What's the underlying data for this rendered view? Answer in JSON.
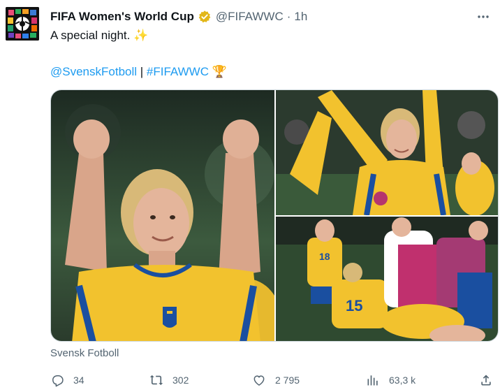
{
  "author": {
    "display_name": "FIFA Women's World Cup",
    "handle": "@FIFAWWC",
    "separator": "·",
    "timestamp": "1h",
    "verified": true,
    "verified_color": "#e2b719"
  },
  "tweet": {
    "line1_text": "A special night.",
    "line1_emoji": "✨",
    "mention": "@SvenskFotboll",
    "divider": "|",
    "hashtag": "#FIFAWWC",
    "trophy_emoji": "🏆",
    "media_caption": "Svensk Fotboll"
  },
  "actions": {
    "replies": "34",
    "retweets": "302",
    "likes": "2 795",
    "views": "63,3 k"
  },
  "colors": {
    "link": "#1d9bf0",
    "secondary_text": "#536471",
    "kit_yellow": "#f2c22e",
    "kit_blue": "#1a4fa0"
  }
}
